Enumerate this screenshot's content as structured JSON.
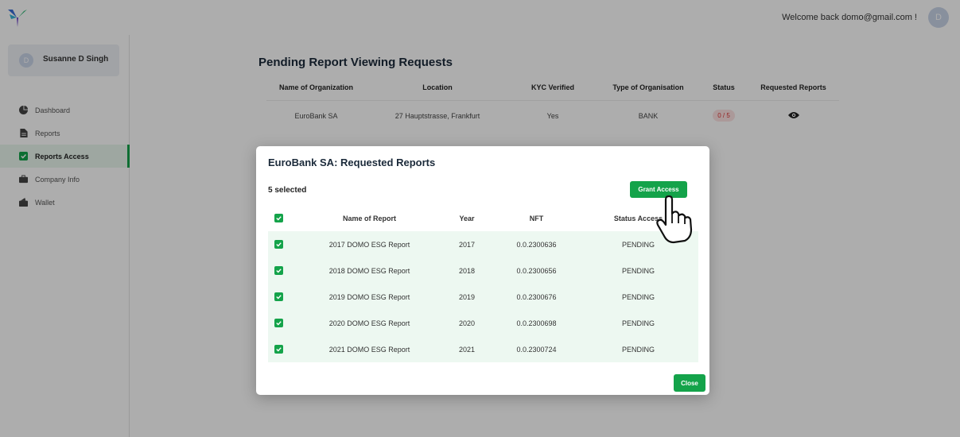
{
  "header": {
    "welcome_text": "Welcome back domo@gmail.com !",
    "avatar_initial": "D"
  },
  "sidebar": {
    "profile": {
      "name": "Susanne D Singh",
      "initial": "D"
    },
    "items": [
      {
        "label": "Dashboard",
        "icon": "pie-chart-icon",
        "active": false
      },
      {
        "label": "Reports",
        "icon": "document-icon",
        "active": false
      },
      {
        "label": "Reports Access",
        "icon": "checkbox-icon",
        "active": true
      },
      {
        "label": "Company Info",
        "icon": "briefcase-icon",
        "active": false
      },
      {
        "label": "Wallet",
        "icon": "wallet-icon",
        "active": false
      }
    ]
  },
  "main": {
    "title": "Pending Report Viewing Requests",
    "columns": [
      "Name of Organization",
      "Location",
      "KYC Verified",
      "Type of Organisation",
      "Status",
      "Requested Reports"
    ],
    "rows": [
      {
        "organization": "EuroBank SA",
        "location": "27 Hauptstrasse, Frankfurt",
        "kyc": "Yes",
        "type": "BANK",
        "status": "0 / 5",
        "requested_icon": "eye-icon"
      }
    ]
  },
  "modal": {
    "title": "EuroBank SA: Requested Reports",
    "selected_text": "5 selected",
    "grant_label": "Grant Access",
    "close_label": "Close",
    "columns": [
      "Name of Report",
      "Year",
      "NFT",
      "Status Access"
    ],
    "reports": [
      {
        "name": "2017 DOMO ESG Report",
        "year": "2017",
        "nft": "0.0.2300636",
        "status": "PENDING",
        "checked": true
      },
      {
        "name": "2018 DOMO ESG Report",
        "year": "2018",
        "nft": "0.0.2300656",
        "status": "PENDING",
        "checked": true
      },
      {
        "name": "2019 DOMO ESG Report",
        "year": "2019",
        "nft": "0.0.2300676",
        "status": "PENDING",
        "checked": true
      },
      {
        "name": "2020 DOMO ESG Report",
        "year": "2020",
        "nft": "0.0.2300698",
        "status": "PENDING",
        "checked": true
      },
      {
        "name": "2021 DOMO ESG Report",
        "year": "2021",
        "nft": "0.0.2300724",
        "status": "PENDING",
        "checked": true
      }
    ]
  },
  "colors": {
    "accent": "#14a34a",
    "row_tint": "#edf8f1",
    "title": "#1b2a3a"
  }
}
